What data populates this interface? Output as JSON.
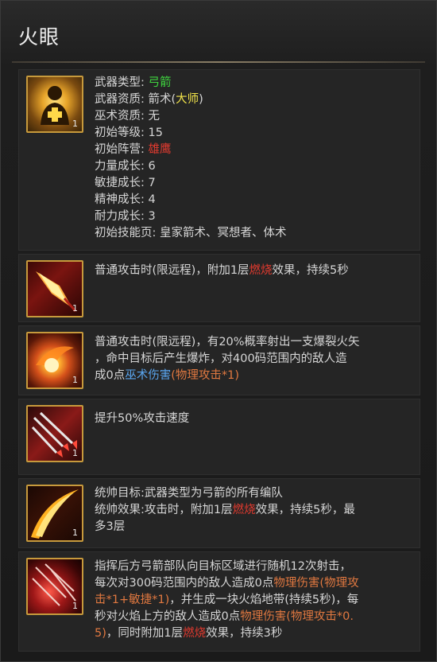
{
  "title": "火眼",
  "stats": {
    "icon": "gold-cross-figure-icon",
    "level": "1",
    "rows": [
      {
        "label": "武器类型: ",
        "value": "弓箭",
        "color": "#3fd43f"
      },
      {
        "label": "武器资质: ",
        "value": "箭术(",
        "value_hl": "大师",
        "value_tail": ")",
        "hl_color": "#f0e24a"
      },
      {
        "label": "巫术资质: ",
        "value": "无"
      },
      {
        "label": "初始等级: ",
        "value": "15"
      },
      {
        "label": "初始阵营: ",
        "value": "雄鹰",
        "color": "#e03a2f"
      },
      {
        "label": "力量成长: ",
        "value": "6"
      },
      {
        "label": "敏捷成长: ",
        "value": "7"
      },
      {
        "label": "精神成长: ",
        "value": "4"
      },
      {
        "label": "耐力成长: ",
        "value": "3"
      },
      {
        "label": "初始技能页: ",
        "value": "皇家箭术、冥想者、体术"
      }
    ]
  },
  "skills": [
    {
      "icon": "flaming-arrowhead-icon",
      "level": "1",
      "text": [
        "普通攻击时(限远程)，附加1层",
        "燃烧",
        "效果，持续5秒"
      ]
    },
    {
      "icon": "fire-explosion-icon",
      "level": "1",
      "line1": "普通攻击时(限远程)，有20%概率射出一支爆裂火矢",
      "line2": "，命中目标后产生爆炸，对400码范围内的敌人造",
      "line3a": "成0点",
      "line3b": "巫术伤害",
      "line3c": "(物理攻击*1)"
    },
    {
      "icon": "multiple-arrows-icon",
      "level": "1",
      "text": "提升50%攻击速度"
    },
    {
      "icon": "fire-slash-icon",
      "level": "1",
      "line1": "统帅目标:武器类型为弓箭的所有编队",
      "line2a": "统帅效果:攻击时，附加1层",
      "line2b": "燃烧",
      "line2c": "效果，持续5秒，最",
      "line3": "多3层"
    },
    {
      "icon": "arrow-rain-icon",
      "level": "1",
      "line1": "指挥后方弓箭部队向目标区域进行随机12次射击，",
      "line2a": "每次对300码范围内的敌人造成0点",
      "line2b": "物理伤害(物理攻",
      "line3a": "击*1+敏捷*1)",
      "line3b": "，并生成一块火焰地带(持续5秒)，每",
      "line4a": "秒对火焰上方的敌人造成0点",
      "line4b": "物理伤害(物理攻击*0.",
      "line5a": "5)",
      "line5b": "，同时附加1层",
      "line5c": "燃烧",
      "line5d": "效果，持续3秒"
    }
  ],
  "colors": {
    "green": "#3fd43f",
    "yellow": "#f0e24a",
    "red": "#e03a2f",
    "blue": "#5aa6f0",
    "orange": "#e07840",
    "icon_border": "#c79a3c"
  }
}
